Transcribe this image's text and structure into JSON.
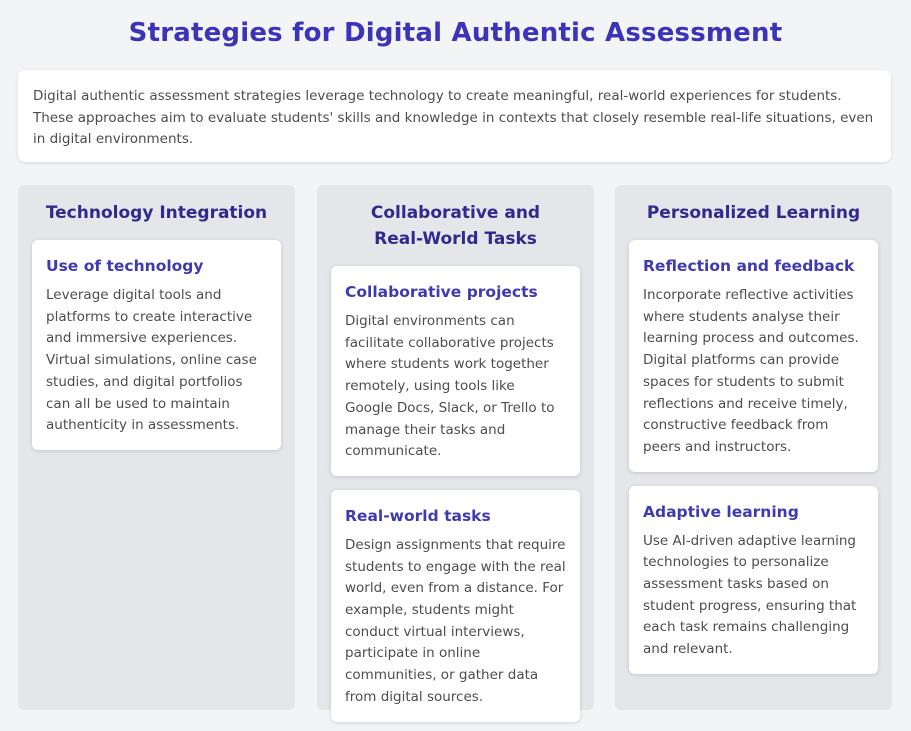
{
  "page": {
    "title": "Strategies for Digital Authentic Assessment",
    "intro": "Digital authentic assessment strategies leverage technology to create meaningful, real-world experiences for students. These approaches aim to evaluate students' skills and knowledge in contexts that closely resemble real-life situations, even in digital environments."
  },
  "columns": [
    {
      "title": "Technology Integration",
      "cards": [
        {
          "title": "Use of technology",
          "body": "Leverage digital tools and platforms to create interactive and immersive experiences. Virtual simulations, online case studies, and digital portfolios can all be used to maintain authenticity in assessments."
        }
      ]
    },
    {
      "title": "Collaborative and Real-World Tasks",
      "cards": [
        {
          "title": "Collaborative projects",
          "body": "Digital environments can facilitate collaborative projects where students work together remotely, using tools like Google Docs, Slack, or Trello to manage their tasks and communicate."
        },
        {
          "title": "Real-world tasks",
          "body": "Design assignments that require students to engage with the real world, even from a distance. For example, students might conduct virtual interviews, participate in online communities, or gather data from digital sources."
        }
      ]
    },
    {
      "title": "Personalized Learning",
      "cards": [
        {
          "title": "Reflection and feedback",
          "body": "Incorporate reflective activities where students analyse their learning process and outcomes. Digital platforms can provide spaces for students to submit reflections and receive timely, constructive feedback from peers and instructors."
        },
        {
          "title": "Adaptive learning",
          "body": "Use AI-driven adaptive learning technologies to personalize assessment tasks based on student progress, ensuring that each task remains challenging and relevant."
        }
      ]
    }
  ],
  "colors": {
    "title": "#3b33b8",
    "column_title": "#2f2a8c",
    "card_title": "#3f3ab0",
    "column_bg": "#e5e6ea",
    "page_bg": "#f3f4f6"
  }
}
